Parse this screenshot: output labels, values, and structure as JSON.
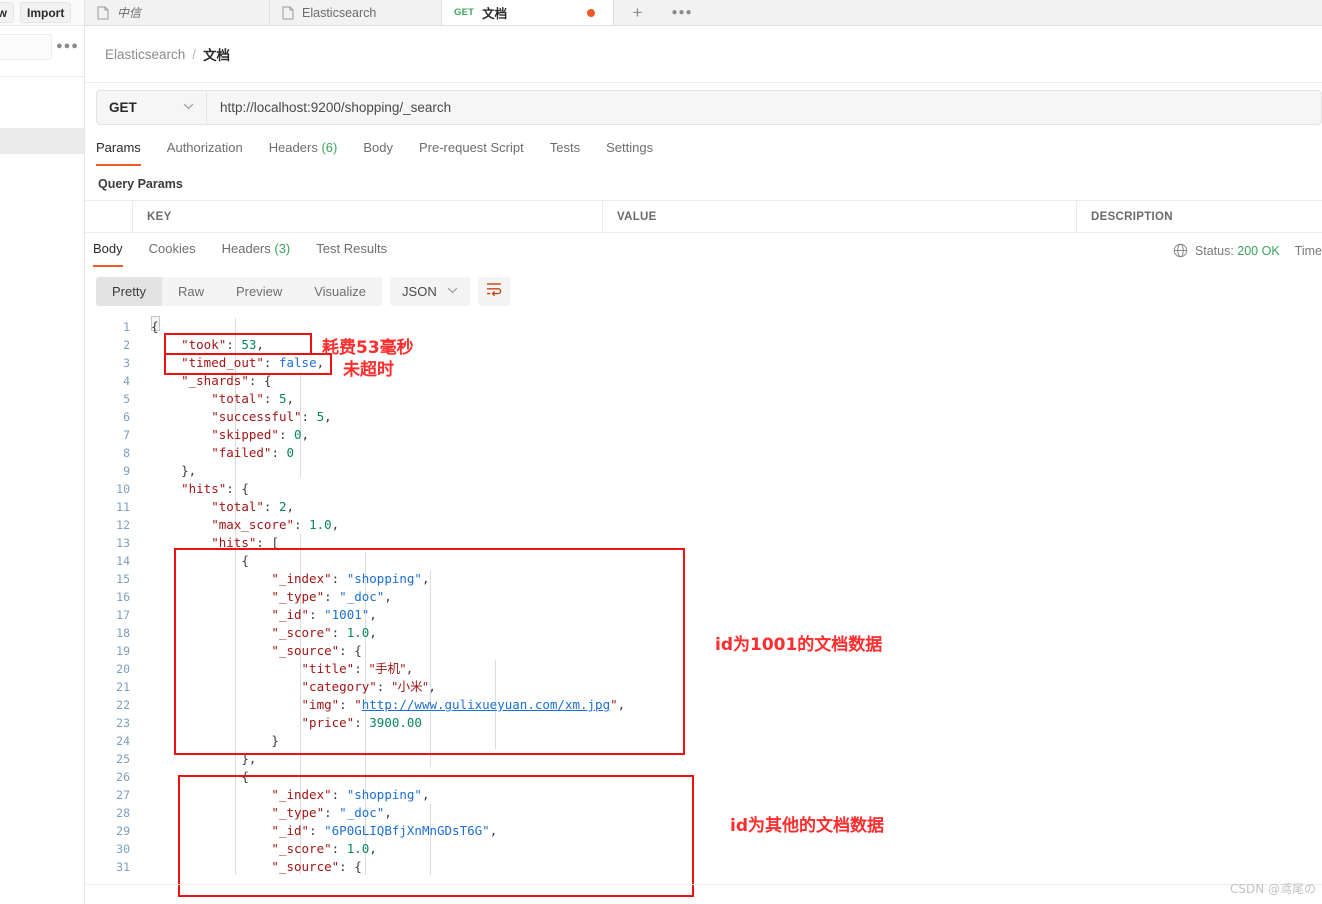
{
  "sidebar": {
    "new_label": "ew",
    "import_label": "Import",
    "more_icon": "more-horizontal-icon"
  },
  "tabs": [
    {
      "label": "中信",
      "icon": "document-icon",
      "method": "",
      "active": false,
      "dirty": false
    },
    {
      "label": "Elasticsearch",
      "icon": "document-icon",
      "method": "",
      "active": false,
      "dirty": false
    },
    {
      "label": "文档",
      "icon": "",
      "method": "GET",
      "active": true,
      "dirty": true
    }
  ],
  "tabbar": {
    "add_label": "+",
    "more_label": "○○○"
  },
  "breadcrumb": {
    "root": "Elasticsearch",
    "separator": "/",
    "current": "文档"
  },
  "request": {
    "method": "GET",
    "url": "http://localhost:9200/shopping/_search",
    "chevron": "⌄"
  },
  "request_tabs": [
    {
      "label": "Params",
      "count": "",
      "active": true
    },
    {
      "label": "Authorization",
      "count": "",
      "active": false
    },
    {
      "label": "Headers",
      "count": "(6)",
      "active": false
    },
    {
      "label": "Body",
      "count": "",
      "active": false
    },
    {
      "label": "Pre-request Script",
      "count": "",
      "active": false
    },
    {
      "label": "Tests",
      "count": "",
      "active": false
    },
    {
      "label": "Settings",
      "count": "",
      "active": false
    }
  ],
  "query_params": {
    "title": "Query Params",
    "columns": [
      "KEY",
      "VALUE",
      "DESCRIPTION"
    ]
  },
  "response_tabs": [
    {
      "label": "Body",
      "count": "",
      "active": true
    },
    {
      "label": "Cookies",
      "count": "",
      "active": false
    },
    {
      "label": "Headers",
      "count": "(3)",
      "active": false
    },
    {
      "label": "Test Results",
      "count": "",
      "active": false
    }
  ],
  "status": {
    "globe_icon": "globe-icon",
    "prefix": "Status: ",
    "code": "200 OK",
    "time_label": "Time"
  },
  "viewer": {
    "modes": [
      "Pretty",
      "Raw",
      "Preview",
      "Visualize"
    ],
    "active_mode": "Pretty",
    "format": "JSON",
    "format_chevron": "⌄",
    "wrap_icon": "wrap-lines-icon"
  },
  "annotations": [
    {
      "text": "耗费53毫秒"
    },
    {
      "text": "未超时"
    },
    {
      "text": "id为1001的文档数据"
    },
    {
      "text": "id为其他的文档数据"
    }
  ],
  "watermark": "CSDN @鸢尾の",
  "response_body": {
    "language": "json",
    "lines": [
      {
        "n": 1,
        "text": "{"
      },
      {
        "n": 2,
        "text": "    \"took\": 53,"
      },
      {
        "n": 3,
        "text": "    \"timed_out\": false,"
      },
      {
        "n": 4,
        "text": "    \"_shards\": {"
      },
      {
        "n": 5,
        "text": "        \"total\": 5,"
      },
      {
        "n": 6,
        "text": "        \"successful\": 5,"
      },
      {
        "n": 7,
        "text": "        \"skipped\": 0,"
      },
      {
        "n": 8,
        "text": "        \"failed\": 0"
      },
      {
        "n": 9,
        "text": "    },"
      },
      {
        "n": 10,
        "text": "    \"hits\": {"
      },
      {
        "n": 11,
        "text": "        \"total\": 2,"
      },
      {
        "n": 12,
        "text": "        \"max_score\": 1.0,"
      },
      {
        "n": 13,
        "text": "        \"hits\": ["
      },
      {
        "n": 14,
        "text": "            {"
      },
      {
        "n": 15,
        "text": "                \"_index\": \"shopping\","
      },
      {
        "n": 16,
        "text": "                \"_type\": \"_doc\","
      },
      {
        "n": 17,
        "text": "                \"_id\": \"1001\","
      },
      {
        "n": 18,
        "text": "                \"_score\": 1.0,"
      },
      {
        "n": 19,
        "text": "                \"_source\": {"
      },
      {
        "n": 20,
        "text": "                    \"title\": \"手机\","
      },
      {
        "n": 21,
        "text": "                    \"category\": \"小米\","
      },
      {
        "n": 22,
        "text": "                    \"img\": \"http://www.gulixueyuan.com/xm.jpg\","
      },
      {
        "n": 23,
        "text": "                    \"price\": 3900.00"
      },
      {
        "n": 24,
        "text": "                }"
      },
      {
        "n": 25,
        "text": "            },"
      },
      {
        "n": 26,
        "text": "            {"
      },
      {
        "n": 27,
        "text": "                \"_index\": \"shopping\","
      },
      {
        "n": 28,
        "text": "                \"_type\": \"_doc\","
      },
      {
        "n": 29,
        "text": "                \"_id\": \"6P0GLIQBfjXnMnGDsT6G\","
      },
      {
        "n": 30,
        "text": "                \"_score\": 1.0,"
      },
      {
        "n": 31,
        "text": "                \"_source\": {"
      }
    ],
    "values": {
      "took": 53,
      "timed_out": false,
      "shards_total": 5,
      "shards_successful": 5,
      "shards_skipped": 0,
      "shards_failed": 0,
      "hits_total": 2,
      "max_score": 1.0,
      "hit1_index": "shopping",
      "hit1_type": "_doc",
      "hit1_id": "1001",
      "hit1_score": 1.0,
      "hit1_title": "手机",
      "hit1_category": "小米",
      "hit1_img": "http://www.gulixueyuan.com/xm.jpg",
      "hit1_price": "3900.00",
      "hit2_index": "shopping",
      "hit2_type": "_doc",
      "hit2_id": "6P0GLIQBfjXnMnGDsT6G",
      "hit2_score": 1.0
    }
  },
  "colors": {
    "accent": "#f15a24",
    "green": "#3ba35b",
    "annotation_red": "#ff2d2d",
    "box_red": "#ee1111",
    "json_key": "#a31515",
    "json_number": "#098658",
    "json_bool": "#1d6fd6",
    "linenum": "#7d9fbe"
  }
}
